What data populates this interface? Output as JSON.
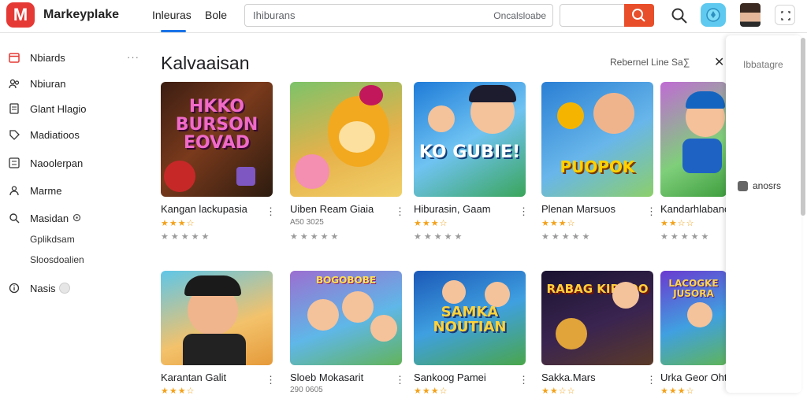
{
  "app": {
    "logo_letter": "M",
    "brand": "Markeyplake"
  },
  "nav": {
    "tabs": [
      "Inleuras",
      "Bole"
    ]
  },
  "search": {
    "placeholder": "Ihiburans",
    "right_text": "Oncalsloabe"
  },
  "sidebar": {
    "items": [
      {
        "label": "Nbiards",
        "icon": "calendar-icon"
      },
      {
        "label": "Nbiuran",
        "icon": "people-icon"
      },
      {
        "label": "Glant Hlagio",
        "icon": "document-icon"
      },
      {
        "label": "Madiatioos",
        "icon": "tag-icon"
      },
      {
        "label": "Naoolerpan",
        "icon": "list-icon"
      },
      {
        "label": "Marme",
        "icon": "group-icon"
      },
      {
        "label": "Masidan",
        "icon": "search-icon"
      },
      {
        "label": "Nasis",
        "icon": "info-icon"
      }
    ],
    "sub_items": [
      "Gplikdsam",
      "Sloosdoalien"
    ],
    "more_label": "···"
  },
  "main": {
    "title": "Kalvaaisan",
    "toolbar_text": "Rebernel Line Sa∑",
    "close_label": "✕"
  },
  "cards": [
    {
      "title": "Kangan lackupasia",
      "art": "HKKO BURSON EOVAD",
      "rating": "★★★☆",
      "stars2": "★★★★★"
    },
    {
      "title": "Uiben Ream Giaia",
      "art": "",
      "sub": "A50 3025",
      "stars2": "★★★★★"
    },
    {
      "title": "Hiburasin, Gaam",
      "art": "KO GUBIE!",
      "rating": "★★★☆",
      "stars2": "★★★★★"
    },
    {
      "title": "Plenan Marsuos",
      "art": "PUOPOK",
      "rating": "★★★☆",
      "stars2": "★★★★★"
    },
    {
      "title": "Kandarhlabanc",
      "art": "",
      "rating": "★★☆☆",
      "stars2": "★★★★★"
    },
    {
      "title": "Karantan Galit",
      "art": "",
      "rating": "★★★☆",
      "stars2": ""
    },
    {
      "title": "Sloeb Mokasarit",
      "art": "BOGOBOBE",
      "sub": "290 0605",
      "stars2": ""
    },
    {
      "title": "Sankoog Pamei",
      "art": "SAMKA NOUTIAN",
      "rating": "★★★☆",
      "stars2": ""
    },
    {
      "title": "Sakka.Mars",
      "art": "RABAG KIRKOO",
      "rating": "★★☆☆",
      "stars2": ""
    },
    {
      "title": "Urka Geor Ohtr",
      "art": "LACOGKE JUSORA",
      "rating": "★★★☆",
      "stars2": ""
    }
  ],
  "right_panel": {
    "header": "Ibbatagre",
    "item": "anosrs"
  },
  "colors": {
    "accent": "#1a73e8",
    "brand": "#e53935",
    "search_button": "#e94e2a",
    "star": "#f3a21b"
  }
}
